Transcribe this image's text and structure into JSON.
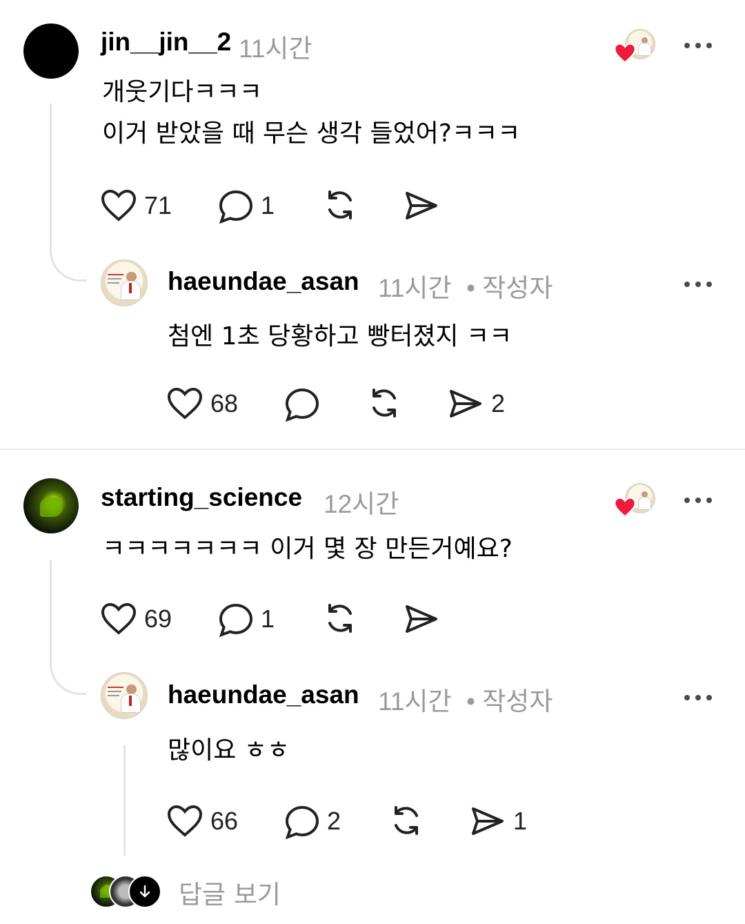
{
  "comments": [
    {
      "username": "jin__jin__2",
      "time": "11시간",
      "lines": [
        "개웃기다ㅋㅋㅋ",
        "이거 받았을 때 무슨 생각 들었어?ㅋㅋㅋ"
      ],
      "likes": "71",
      "replies": "1",
      "reply": {
        "username": "haeundae_asan",
        "time": "11시간",
        "author_tag": "• 작성자",
        "text": "첨엔 1초 당황하고 빵터졌지 ㅋㅋ",
        "likes": "68",
        "shares": "2"
      }
    },
    {
      "username": "starting_science",
      "time": "12시간",
      "lines": [
        "ㅋㅋㅋㅋㅋㅋㅋ 이거 몇 장 만든거예요?"
      ],
      "likes": "69",
      "replies": "1",
      "reply": {
        "username": "haeundae_asan",
        "time": "11시간",
        "author_tag": "• 작성자",
        "text": "많이요 ㅎㅎ",
        "likes": "66",
        "replies": "2",
        "shares": "1"
      }
    }
  ],
  "view_replies_label": "답글 보기",
  "colors": {
    "heart": "#ed1c3a",
    "muted": "#9a9a9a",
    "divider": "#ececec"
  },
  "icons": [
    "heart-icon",
    "comment-icon",
    "repost-icon",
    "share-icon",
    "more-icon",
    "arrow-down-icon"
  ]
}
